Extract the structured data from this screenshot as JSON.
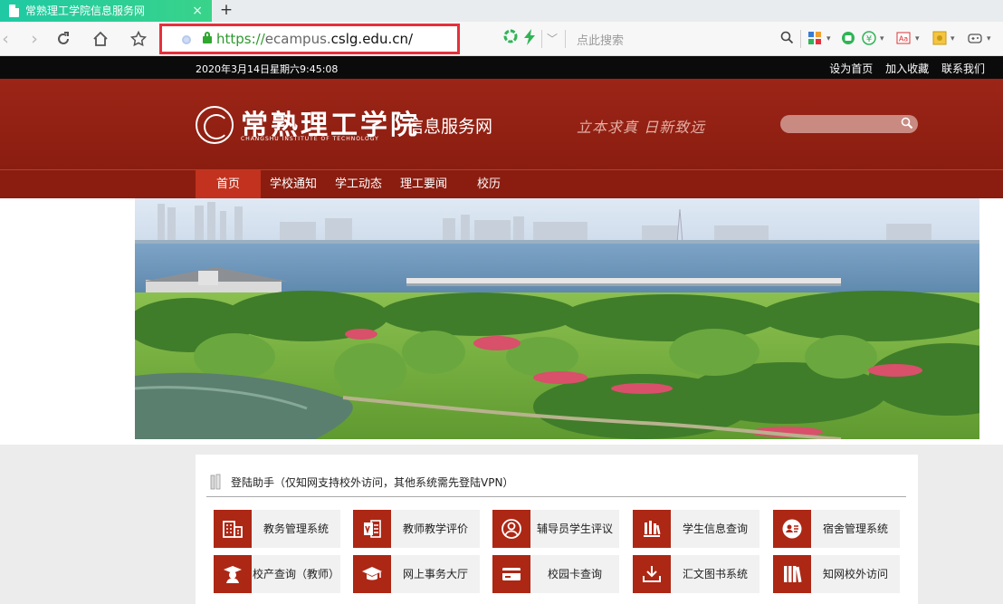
{
  "browser": {
    "tab_title": "常熟理工学院信息服务网",
    "tab_close": "×",
    "new_tab": "+",
    "url_scheme": "https://",
    "url_sub": "ecampus.",
    "url_host": "cslg.edu.cn/",
    "search_placeholder": "点此搜索"
  },
  "topbar": {
    "datetime": "2020年3月14日星期六9:45:08",
    "links": [
      "设为首页",
      "加入收藏",
      "联系我们"
    ]
  },
  "header": {
    "logo_cn": "常熟理工学院",
    "logo_en": "CHANGSHU INSTITUTE OF TECHNOLOGY",
    "site_name": "信息服务网",
    "motto": "立本求真 日新致远"
  },
  "nav": [
    "首页",
    "学校通知",
    "学工动态",
    "理工要闻",
    "校历"
  ],
  "helper": {
    "title": "登陆助手（仅知网支持校外访问，其他系统需先登陆VPN）",
    "tiles": [
      {
        "label": "教务管理系统",
        "icon": "building-icon"
      },
      {
        "label": "教师教学评价",
        "icon": "office-doc-icon"
      },
      {
        "label": "辅导员学生评议",
        "icon": "person-circle-icon"
      },
      {
        "label": "学生信息查询",
        "icon": "library-icon"
      },
      {
        "label": "宿舍管理系统",
        "icon": "id-card-icon"
      },
      {
        "label": "校产查询（教师）",
        "icon": "graduate-icon"
      },
      {
        "label": "网上事务大厅",
        "icon": "mortarboard-icon"
      },
      {
        "label": "校园卡查询",
        "icon": "card-icon"
      },
      {
        "label": "汇文图书系统",
        "icon": "download-tray-icon"
      },
      {
        "label": "知网校外访问",
        "icon": "books-icon"
      }
    ]
  },
  "colors": {
    "header_red": "#8a1d10",
    "nav_active": "#c2321e",
    "tile_icon_bg": "#ad2715",
    "address_highlight": "#e5303b",
    "tab_green": "#2bcf97"
  }
}
